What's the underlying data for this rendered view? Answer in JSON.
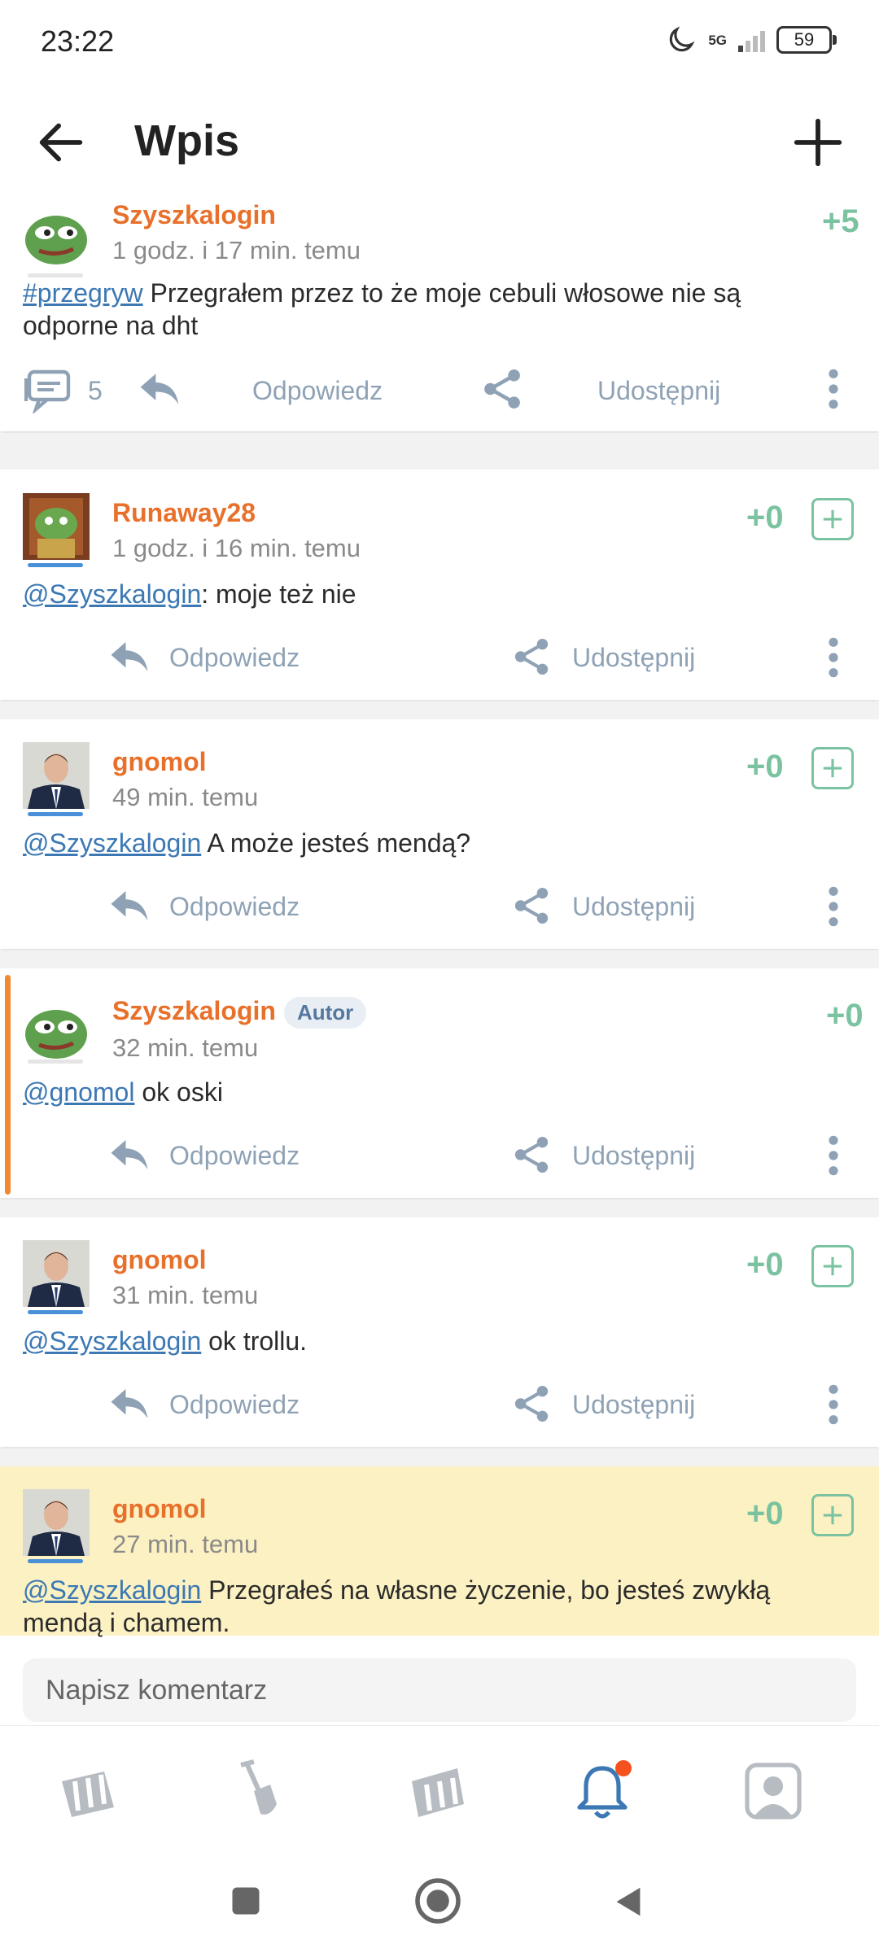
{
  "status_bar": {
    "time": "23:22",
    "network": "5G",
    "battery": "59"
  },
  "app_bar": {
    "title": "Wpis"
  },
  "main_post": {
    "author": "Szyszkalogin",
    "time": "1 godz. i 17 min. temu",
    "votes": "+5",
    "tag": "#przegryw",
    "text": " Przegrałem przez to że moje cebuli włosowe nie są odporne na dht",
    "comment_count": "5",
    "reply_label": "Odpowiedz",
    "share_label": "Udostępnij"
  },
  "comments": [
    {
      "author": "Runaway28",
      "time": "1 godz. i 16 min. temu",
      "votes": "+0",
      "mention": "@Szyszkalogin",
      "text": ": moje też nie",
      "reply_label": "Odpowiedz",
      "share_label": "Udostępnij"
    },
    {
      "author": "gnomol",
      "time": "49 min. temu",
      "votes": "+0",
      "mention": "@Szyszkalogin",
      "text": " A może jesteś mendą?",
      "reply_label": "Odpowiedz",
      "share_label": "Udostępnij"
    },
    {
      "author": "Szyszkalogin",
      "badge": "Autor",
      "time": "32 min. temu",
      "votes": "+0",
      "mention": "@gnomol",
      "text": " ok oski",
      "reply_label": "Odpowiedz",
      "share_label": "Udostępnij"
    },
    {
      "author": "gnomol",
      "time": "31 min. temu",
      "votes": "+0",
      "mention": "@Szyszkalogin",
      "text": " ok trollu.",
      "reply_label": "Odpowiedz",
      "share_label": "Udostępnij"
    },
    {
      "author": "gnomol",
      "time": "27 min. temu",
      "votes": "+0",
      "mention": "@Szyszkalogin",
      "text": " Przegrałeś na własne życzenie, bo jesteś zwykłą mendą i chamem."
    }
  ],
  "comment_input": {
    "placeholder": "Napisz komentarz"
  },
  "colors": {
    "author": "#e8702a",
    "vote": "#7bc3a0",
    "link": "#3c78b4",
    "highlight": "#fcf1c2",
    "author_marker": "#f0892f",
    "action": "#8fa2b5"
  },
  "icons": [
    "back-arrow-icon",
    "plus-icon",
    "comment-icon",
    "reply-icon",
    "share-icon",
    "more-vert-icon",
    "notification-bell-icon",
    "profile-icon"
  ]
}
